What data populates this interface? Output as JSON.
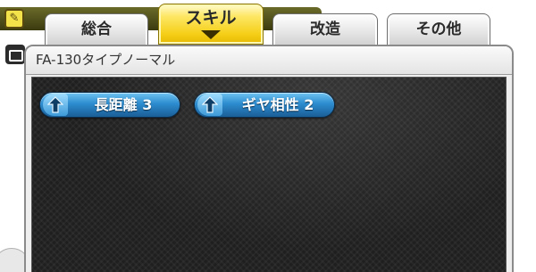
{
  "background": {
    "pencil_icon": "pencil-icon",
    "left_icon": "card-icon"
  },
  "tabs": [
    {
      "label": "総合",
      "active": false
    },
    {
      "label": "スキル",
      "active": true
    },
    {
      "label": "改造",
      "active": false
    },
    {
      "label": "その他",
      "active": false
    }
  ],
  "panel": {
    "title": "FA-130タイプノーマル",
    "skills": [
      {
        "label": "長距離 3",
        "icon": "upgrade-arrow-icon"
      },
      {
        "label": "ギヤ相性 2",
        "icon": "upgrade-arrow-icon"
      }
    ]
  },
  "colors": {
    "active_tab": "#f5cf18",
    "skill_badge": "#2d8ccf",
    "panel_body": "#1f1f1f"
  }
}
